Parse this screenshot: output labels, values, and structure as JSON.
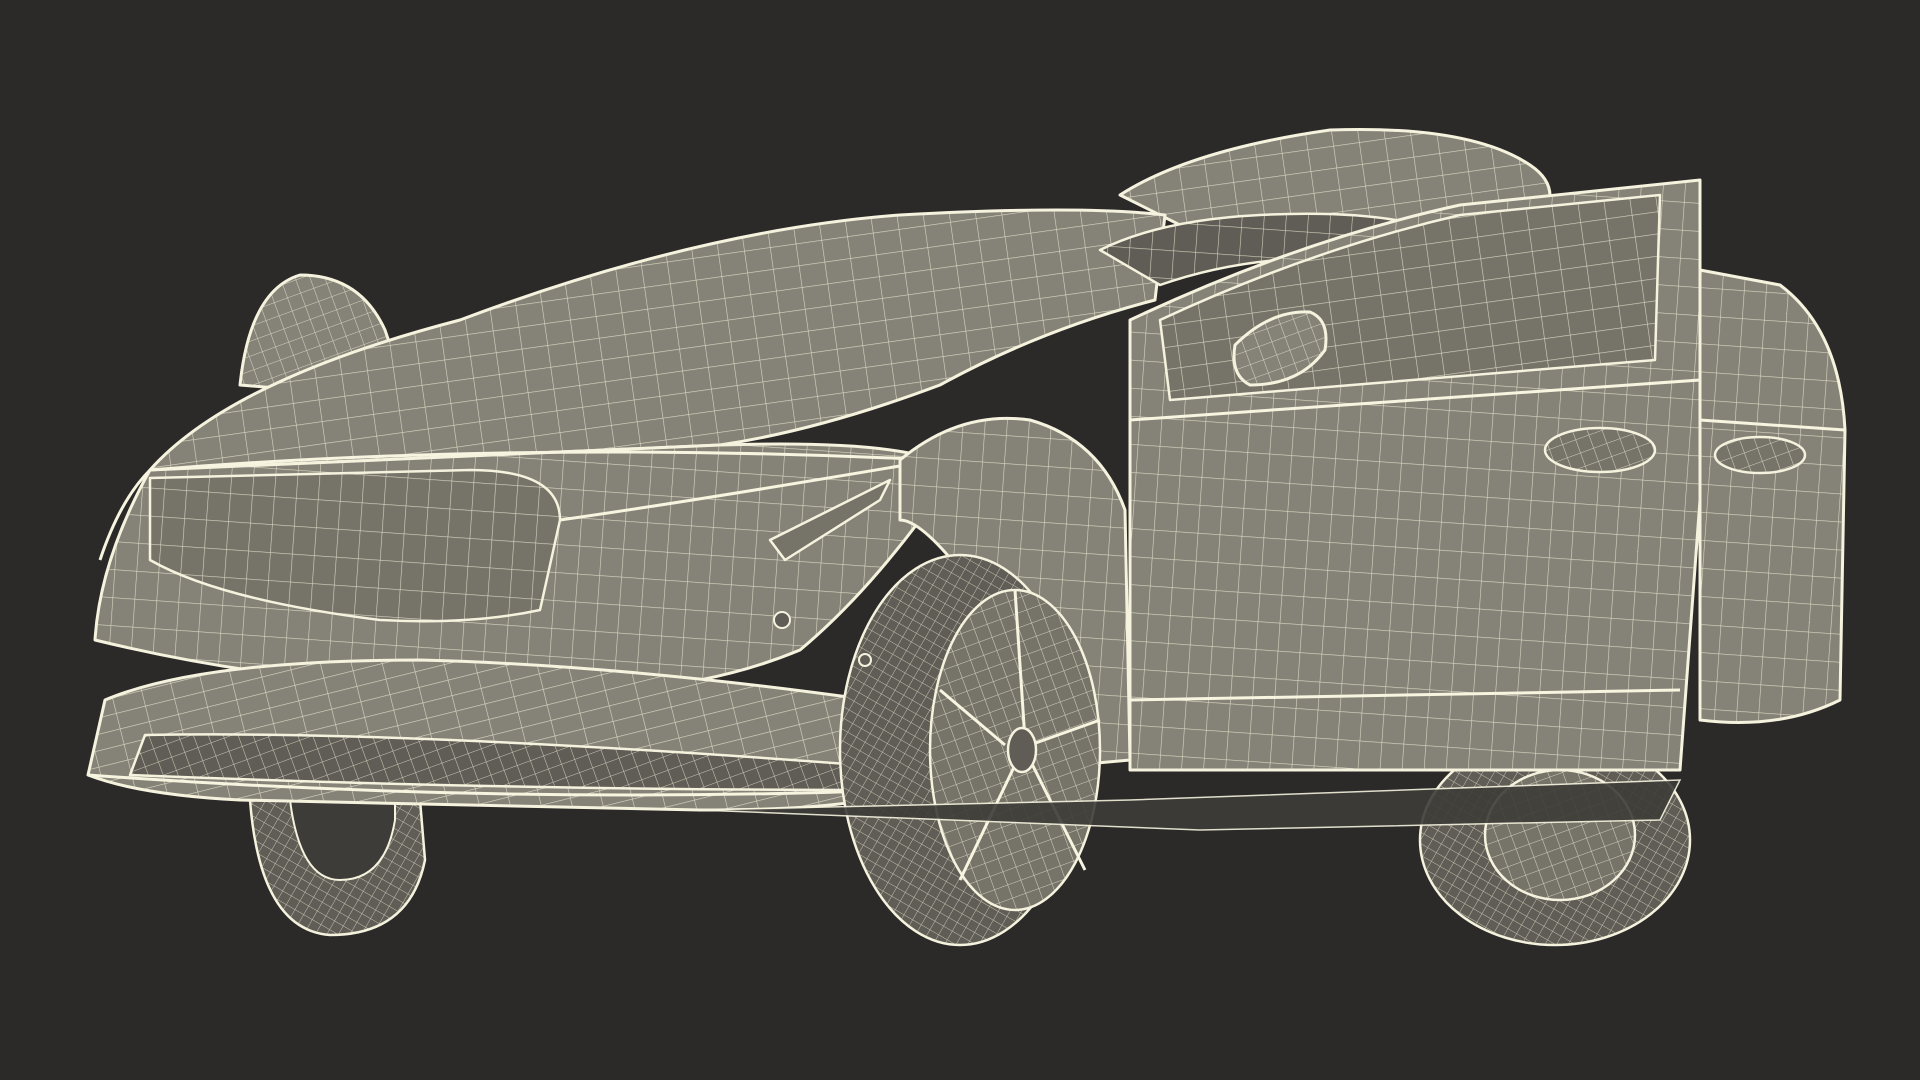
{
  "scene": {
    "background_color": "#2b2a29",
    "mesh_fill_color": "#858377",
    "wire_color": "#f5f2de",
    "subject": "wireframe-car-model"
  }
}
